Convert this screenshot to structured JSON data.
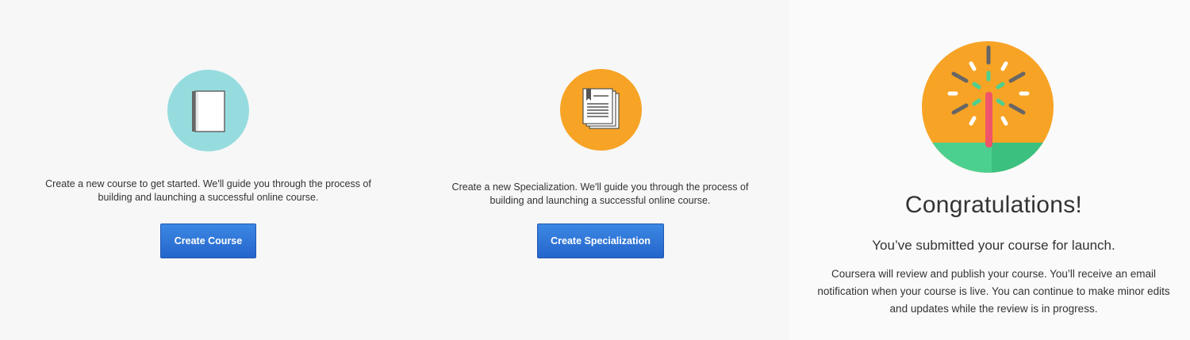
{
  "course_panel": {
    "description": "Create a new course to get started. We'll guide you through the process of building and launching a successful online course.",
    "button_label": "Create Course",
    "icon": "book-icon",
    "icon_bg": "#96dcde"
  },
  "spec_panel": {
    "description": "Create a new Specialization. We'll guide you through the process of building and launching a successful online course.",
    "button_label": "Create Specialization",
    "icon": "documents-stack-icon",
    "icon_bg": "#f7a325"
  },
  "congrats_panel": {
    "icon": "launch-firework-icon",
    "title": "Congratulations!",
    "subtitle": "You’ve submitted your course for launch.",
    "body": "Coursera will review and publish your course. You’ll receive an email notification when your course is live. You can continue to make minor edits and updates while the review is in progress."
  },
  "colors": {
    "button_primary": "#2a6fd6",
    "accent_orange": "#f7a325",
    "accent_teal": "#96dcde",
    "accent_green": "#4cd08f"
  }
}
